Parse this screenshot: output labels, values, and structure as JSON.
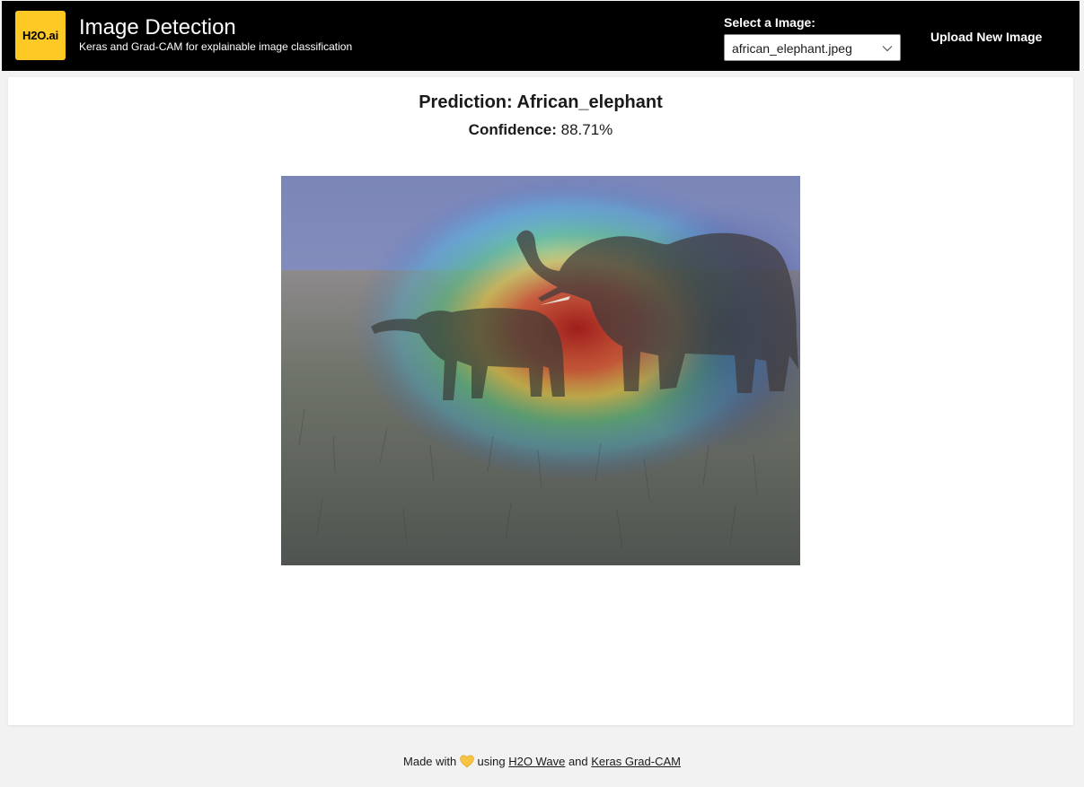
{
  "header": {
    "logo_text": "H2O.ai",
    "title": "Image Detection",
    "subtitle": "Keras and Grad-CAM for explainable image classification",
    "select_label": "Select a Image:",
    "select_value": "african_elephant.jpeg",
    "upload_label": "Upload New Image"
  },
  "main": {
    "prediction_label": "Prediction:",
    "prediction_value": "African_elephant",
    "confidence_label": "Confidence:",
    "confidence_value": "88.71%"
  },
  "footer": {
    "made_with": "Made with",
    "using": "using",
    "link1": "H2O Wave",
    "and": "and",
    "link2": "Keras Grad-CAM"
  },
  "colors": {
    "header_bg": "#000000",
    "logo_bg": "#fec925",
    "heart": "#f7c342",
    "page_bg": "#f2f2f2"
  }
}
